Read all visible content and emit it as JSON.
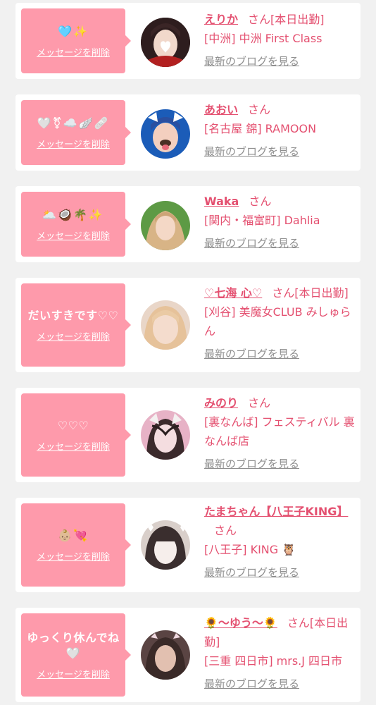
{
  "blog_label": "最新のブログを見る",
  "delete_label": "メッセージを削除",
  "san_label": "さん",
  "today_label": "[本日出勤]",
  "items": [
    {
      "message": "🩵✨",
      "name": "えりか",
      "today": "[本日出勤]",
      "shop": "[中洲] 中洲 First Class",
      "avatar_colors": [
        "#3a2526",
        "#ffffff"
      ]
    },
    {
      "message": "🤍⚧☁️🪽🩹",
      "name": "あおい",
      "today": "",
      "shop": "[名古屋 錦] RAMOON",
      "avatar_colors": [
        "#2b68c4",
        "#f2d1c3"
      ]
    },
    {
      "message": "🌥️🥥🌴✨",
      "name": "Waka",
      "today": "",
      "shop": "[関内・福富町] Dahlia",
      "avatar_colors": [
        "#4f8f3d",
        "#d7b08a"
      ]
    },
    {
      "message": "だいすきです♡♡",
      "name": "♡七海 心♡",
      "today": "[本日出勤]",
      "shop": "[刈谷] 美魔女CLUB みしゅらん",
      "avatar_colors": [
        "#d9b9a4",
        "#f3dac8"
      ]
    },
    {
      "message": "♡♡♡",
      "name": "みのり",
      "today": "",
      "shop": "[裏なんば] フェスティバル 裏なんば店",
      "avatar_colors": [
        "#e9b3c8",
        "#f6dde3"
      ]
    },
    {
      "message": "👶🏼💘",
      "name": "たまちゃん【八王子KING】",
      "today": "",
      "shop": "[八王子] KING 🦉",
      "avatar_colors": [
        "#3d3232",
        "#efe8e6"
      ]
    },
    {
      "message": "ゆっくり休んでね🤍",
      "name": "🌻〜ゆう〜🌻",
      "today": "[本日出勤]",
      "shop": "[三重 四日市] mrs.J 四日市",
      "avatar_colors": [
        "#5a4443",
        "#cfa99a"
      ]
    }
  ]
}
